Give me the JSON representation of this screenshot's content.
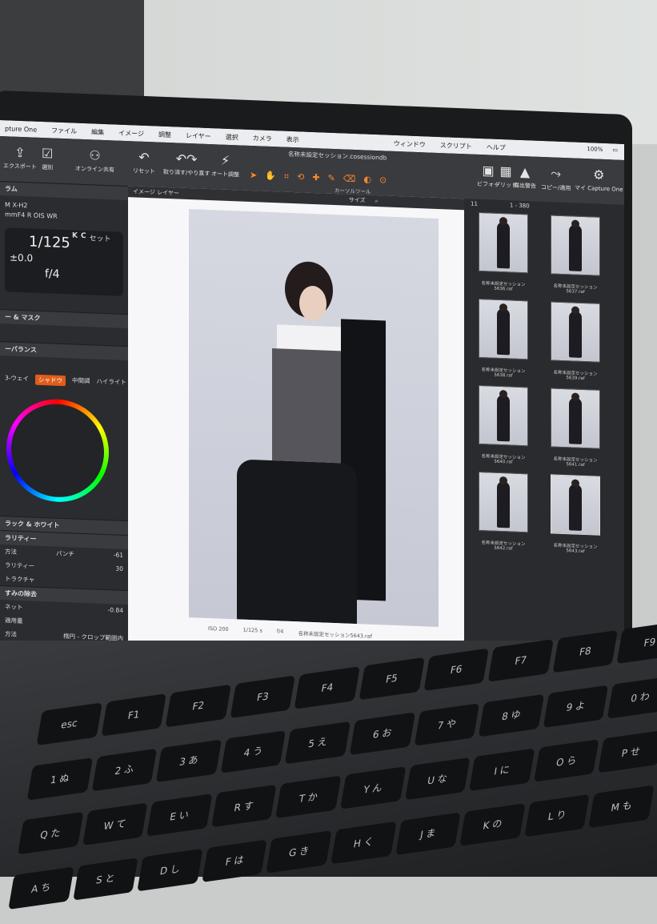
{
  "menubar": {
    "app": "pture One",
    "items": [
      "ファイル",
      "編集",
      "イメージ",
      "調整",
      "レイヤー",
      "選択",
      "カメラ",
      "表示",
      "ウィンドウ",
      "スクリプト",
      "ヘルプ"
    ],
    "battery": "100%"
  },
  "toolbar": {
    "doc_title": "名称未設定セッション.cosessiondb",
    "export": "エクスポート",
    "select": "選別",
    "online_share": "オンライン共有",
    "reset": "リセット",
    "undo_redo": "取り消す/やり直す",
    "auto_adjust": "オート調整",
    "cursor_tools": "カーソルツール",
    "preview": "ビフォー",
    "grid": "グリッド",
    "exposure_warning": "露出警告",
    "copy_apply": "コピー/適用",
    "my_capture_one": "マイ Capture One"
  },
  "left_panel": {
    "section_camera": "ラム",
    "camera_model": "M X-H2",
    "lens": "mmF4 R OIS WR",
    "shutter": "1/125",
    "exposure": "±0.0",
    "aperture": "f/4",
    "k_label": "K",
    "c_label": "C",
    "set_label": "セット",
    "section_layers": "ー & マスク",
    "section_color_balance": "ーバランス",
    "tabs": [
      "3-ウェイ",
      "シャドウ",
      "中間調",
      "ハイライト"
    ],
    "section_bw": "ラック & ホワイト",
    "clarity_label": "ラリティー",
    "method_label": "方法",
    "method_value": "パンチ",
    "clarity_value": "-61",
    "clarity2_label": "ラリティー",
    "clarity2_value": "30",
    "structure_label": "トラクチャ",
    "section_dehaze": "すみの除去",
    "vignette_label": "ネット",
    "vignette_value": "-0.84",
    "apply_label": "適用量",
    "method2_label": "方法",
    "method2_value": "楕円 - クロップ範囲内"
  },
  "viewer": {
    "tab_label": "イメージ レイヤー",
    "size_label": "サイズ",
    "iso": "ISO 200",
    "shutter": "1/125 s",
    "aperture": "f/4",
    "filename": "名称未設定セッション5643.raf"
  },
  "browser": {
    "count": "1 - 380",
    "count_sub": "11",
    "thumbs": [
      "名称未設定セッション5636.raf",
      "名称未設定セッション5637.raf",
      "名称未設定セッション5638.raf",
      "名称未設定セッション5639.raf",
      "名称未設定セッション5640.raf",
      "名称未設定セッション5641.raf",
      "名称未設定セッション5642.raf",
      "名称未設定セッション5643.raf"
    ]
  },
  "keyboard": {
    "keys": [
      "esc",
      "F1",
      "F2",
      "F3",
      "F4",
      "F5",
      "F6",
      "F7",
      "F8",
      "F9",
      "1 ぬ",
      "2 ふ",
      "3 あ",
      "4 う",
      "5 え",
      "6 お",
      "7 や",
      "8 ゆ",
      "9 よ",
      "0 わ",
      "Q た",
      "W て",
      "E い",
      "R す",
      "T か",
      "Y ん",
      "U な",
      "I に",
      "O ら",
      "P せ",
      "A ち",
      "S と",
      "D し",
      "F は",
      "G き",
      "H く",
      "J ま",
      "K の",
      "L り",
      "M も"
    ]
  }
}
